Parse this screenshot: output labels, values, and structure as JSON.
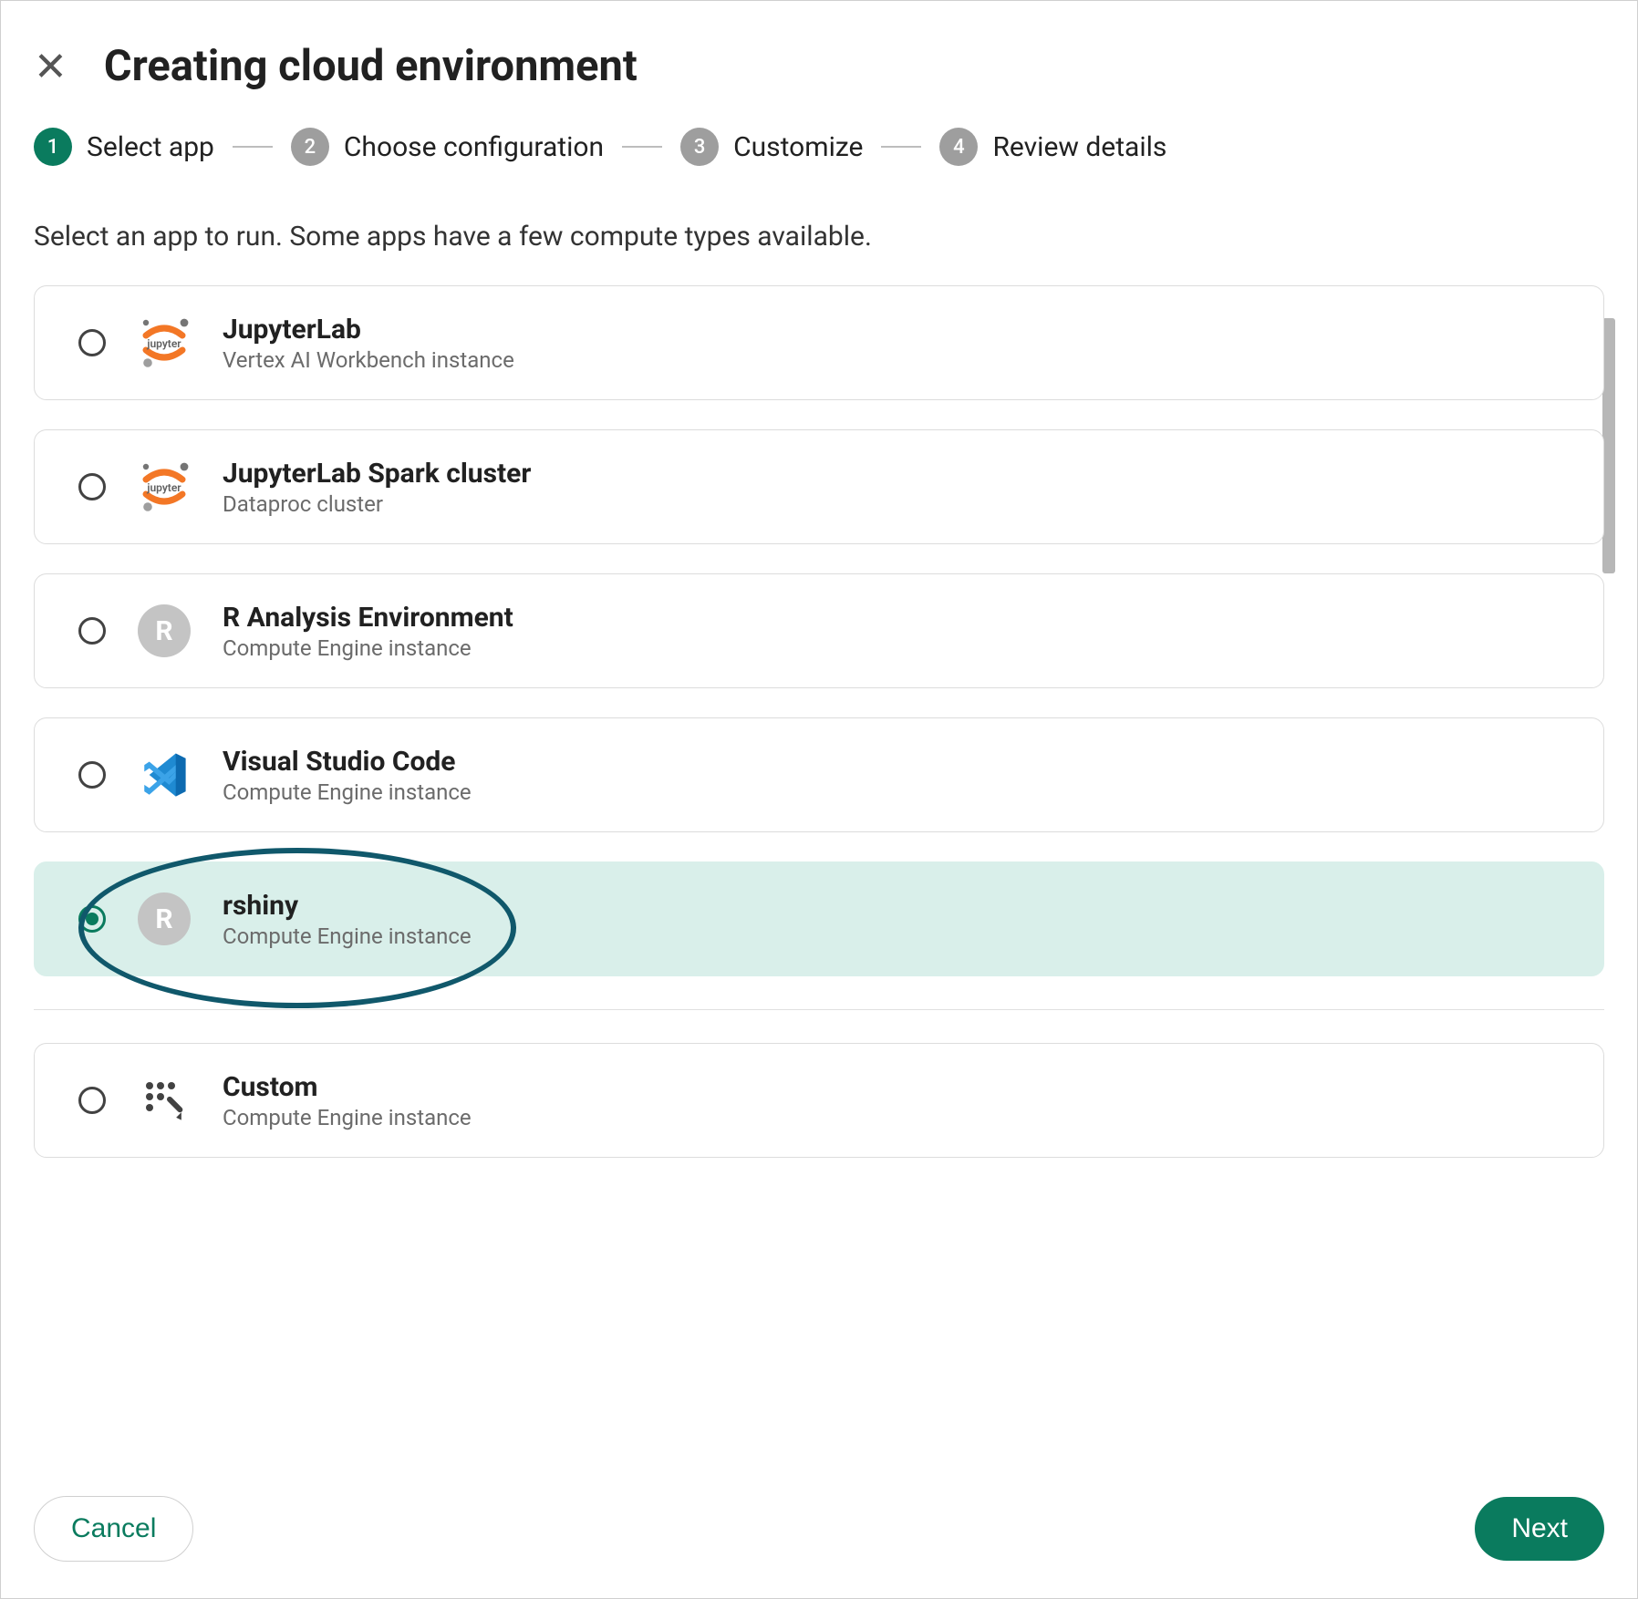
{
  "header": {
    "title": "Creating cloud environment"
  },
  "stepper": {
    "steps": [
      {
        "num": "1",
        "label": "Select app",
        "active": true
      },
      {
        "num": "2",
        "label": "Choose configuration",
        "active": false
      },
      {
        "num": "3",
        "label": "Customize",
        "active": false
      },
      {
        "num": "4",
        "label": "Review details",
        "active": false
      }
    ]
  },
  "description": "Select an app to run. Some apps have a few compute types available.",
  "apps": [
    {
      "name": "JupyterLab",
      "sub": "Vertex AI Workbench instance",
      "icon": "jupyter",
      "selected": false
    },
    {
      "name": "JupyterLab Spark cluster",
      "sub": "Dataproc cluster",
      "icon": "jupyter",
      "selected": false
    },
    {
      "name": "R Analysis Environment",
      "sub": "Compute Engine instance",
      "icon": "r-badge",
      "selected": false
    },
    {
      "name": "Visual Studio Code",
      "sub": "Compute Engine instance",
      "icon": "vscode",
      "selected": false
    },
    {
      "name": "rshiny",
      "sub": "Compute Engine instance",
      "icon": "r-badge",
      "selected": true,
      "highlighted": true
    },
    {
      "divider": true
    },
    {
      "name": "Custom",
      "sub": "Compute Engine instance",
      "icon": "custom",
      "selected": false
    }
  ],
  "footer": {
    "cancel": "Cancel",
    "next": "Next"
  },
  "colors": {
    "accent": "#0a7b5e",
    "selected_bg": "#d9efea",
    "highlight_ring": "#10586b"
  }
}
